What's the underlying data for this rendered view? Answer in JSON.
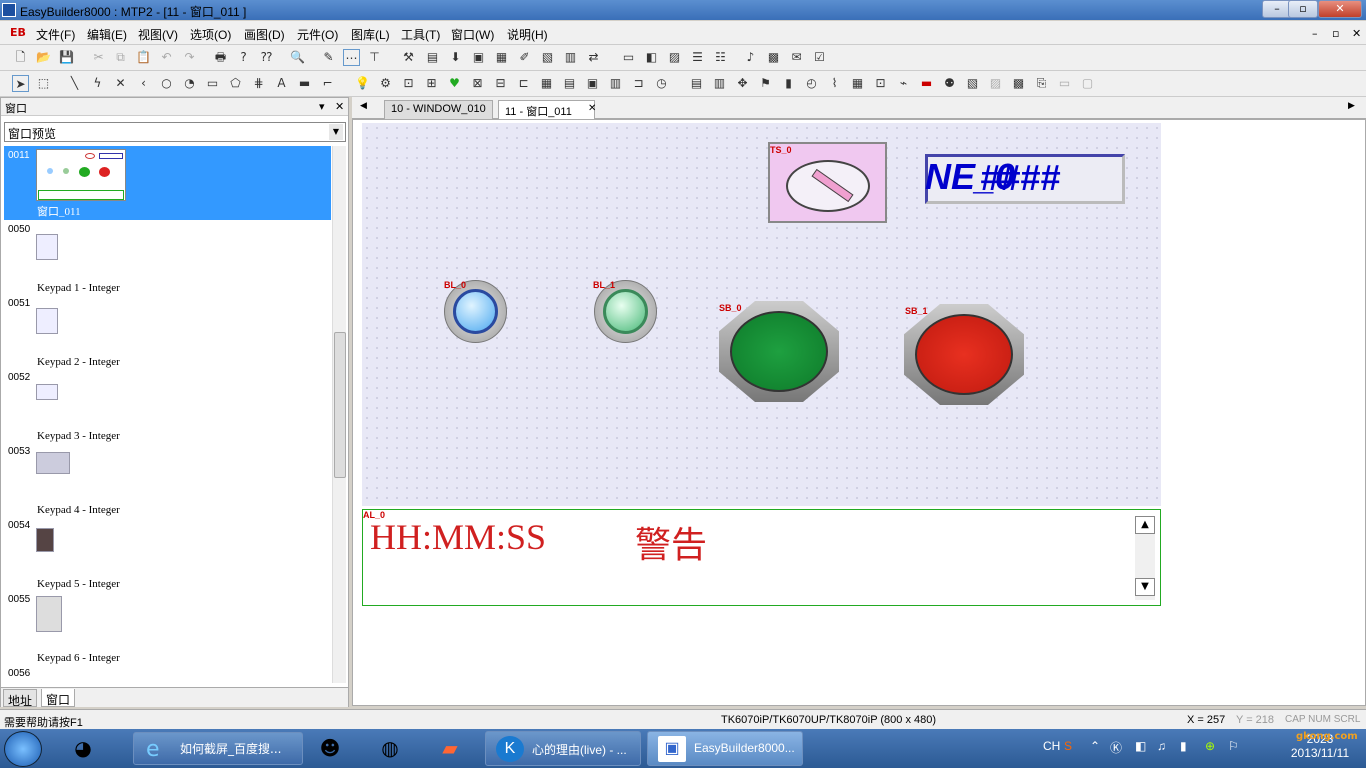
{
  "window": {
    "title": "EasyBuilder8000 : MTP2 - [11 - 窗口_011 ]",
    "min": "–",
    "max": "▫",
    "close": "✕"
  },
  "menu": {
    "eb": "EB",
    "items": [
      "文件(F)",
      "编辑(E)",
      "视图(V)",
      "选项(O)",
      "画图(D)",
      "元件(O)",
      "图库(L)",
      "工具(T)",
      "窗口(W)",
      "说明(H)"
    ]
  },
  "panel": {
    "title": "窗口",
    "pin": "▾",
    "close": "✕",
    "combo": "窗口预览",
    "combo_arrow": "▼",
    "items": [
      {
        "num": "0011",
        "name": "窗口_011"
      },
      {
        "num": "0050",
        "name": "Keypad 1 - Integer"
      },
      {
        "num": "0051",
        "name": "Keypad 2 - Integer"
      },
      {
        "num": "0052",
        "name": "Keypad 3 - Integer"
      },
      {
        "num": "0053",
        "name": "Keypad 4 - Integer"
      },
      {
        "num": "0054",
        "name": "Keypad 5 - Integer"
      },
      {
        "num": "0055",
        "name": "Keypad 6 - Integer"
      },
      {
        "num": "0056",
        "name": ""
      }
    ],
    "tabs": [
      "地址",
      "窗口"
    ]
  },
  "doc_tabs": {
    "left_arrow": "◀",
    "right_arrow": "▶",
    "tab1": "10 - WINDOW_010",
    "tab2": "11 - 窗口_011",
    "tab_close": "✕"
  },
  "canvas": {
    "ts_label": "TS_0",
    "ne_label": "NE_0",
    "ne_value": "####",
    "bl0": "BL_0",
    "bl1": "BL_1",
    "sb0": "SB_0",
    "sb1": "SB_1",
    "al_label": "AL_0",
    "alarm_time": "HH:MM:SS",
    "alarm_text": "警告",
    "scroll_up": "▲",
    "scroll_down": "▼"
  },
  "status": {
    "help": "需要帮助请按F1",
    "model": "TK6070iP/TK6070UP/TK8070iP (800 x 480)",
    "x": "X = 257",
    "y": "Y = 218",
    "caps": "CAP NUM SCRL"
  },
  "taskbar": {
    "tasks": [
      "如何截屏_百度搜...",
      "心的理由(live) - ...",
      "EasyBuilder8000..."
    ],
    "lang": "CH",
    "time": "2023",
    "date": "2013/11/11",
    "watermark": "gkong.com"
  },
  "colors": {
    "accent": "#3399ff",
    "alarm": "#d02020",
    "title": "#3a6fb8"
  }
}
